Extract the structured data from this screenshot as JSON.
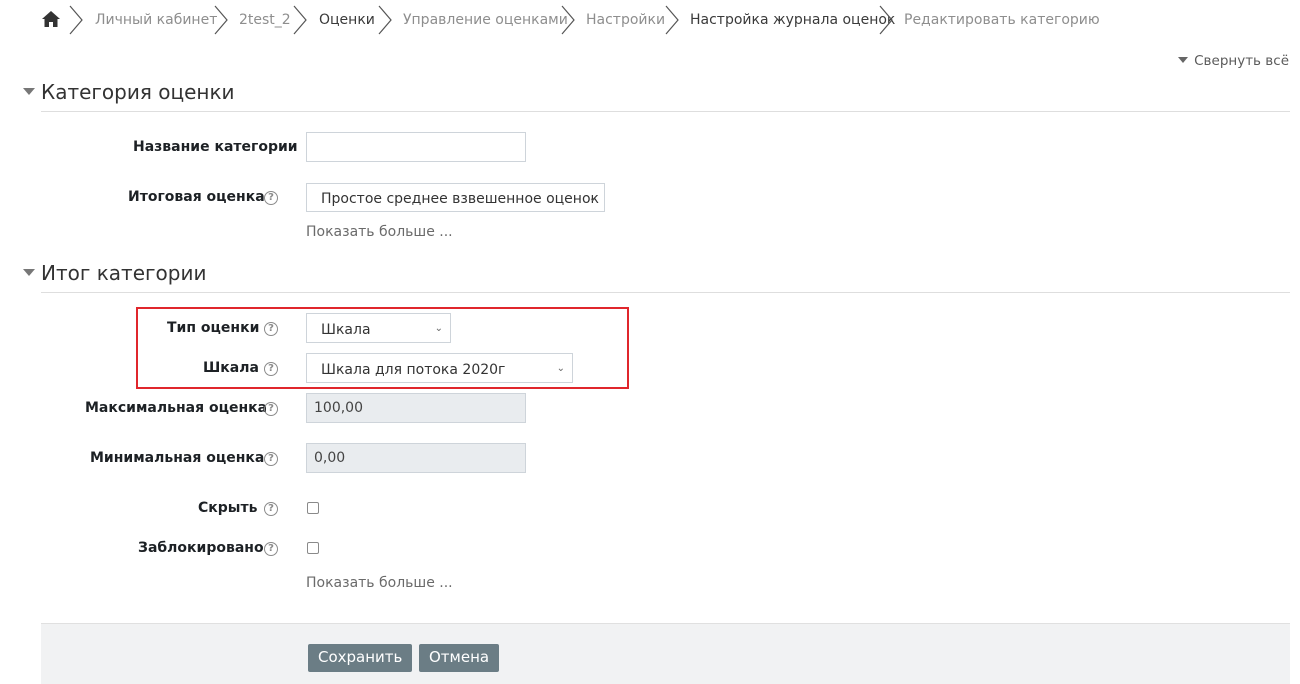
{
  "breadcrumb": {
    "home_icon": "home-icon",
    "items": [
      "Личный кабинет",
      "2test_2",
      "Оценки",
      "Управление оценками",
      "Настройки",
      "Настройка журнала оценок",
      "Редактировать категорию"
    ]
  },
  "collapse_all": "Свернуть всё",
  "section1": {
    "title": "Категория оценки",
    "category_name_label": "Название категории",
    "category_name_value": "",
    "aggregation_label": "Итоговая оценка",
    "aggregation_value": "Простое среднее взвешенное оценок",
    "show_more": "Показать больше ..."
  },
  "section2": {
    "title": "Итог категории",
    "grade_type_label": "Тип оценки",
    "grade_type_value": "Шкала",
    "scale_label": "Шкала",
    "scale_value": "Шкала для потока 2020г",
    "max_grade_label": "Максимальная оценка",
    "max_grade_value": "100,00",
    "min_grade_label": "Минимальная оценка",
    "min_grade_value": "0,00",
    "hidden_label": "Скрыть",
    "locked_label": "Заблокировано",
    "show_more": "Показать больше ..."
  },
  "buttons": {
    "save": "Сохранить",
    "cancel": "Отмена"
  },
  "colors": {
    "highlight_border": "#e0262c",
    "button_bg": "#6b7d85"
  }
}
